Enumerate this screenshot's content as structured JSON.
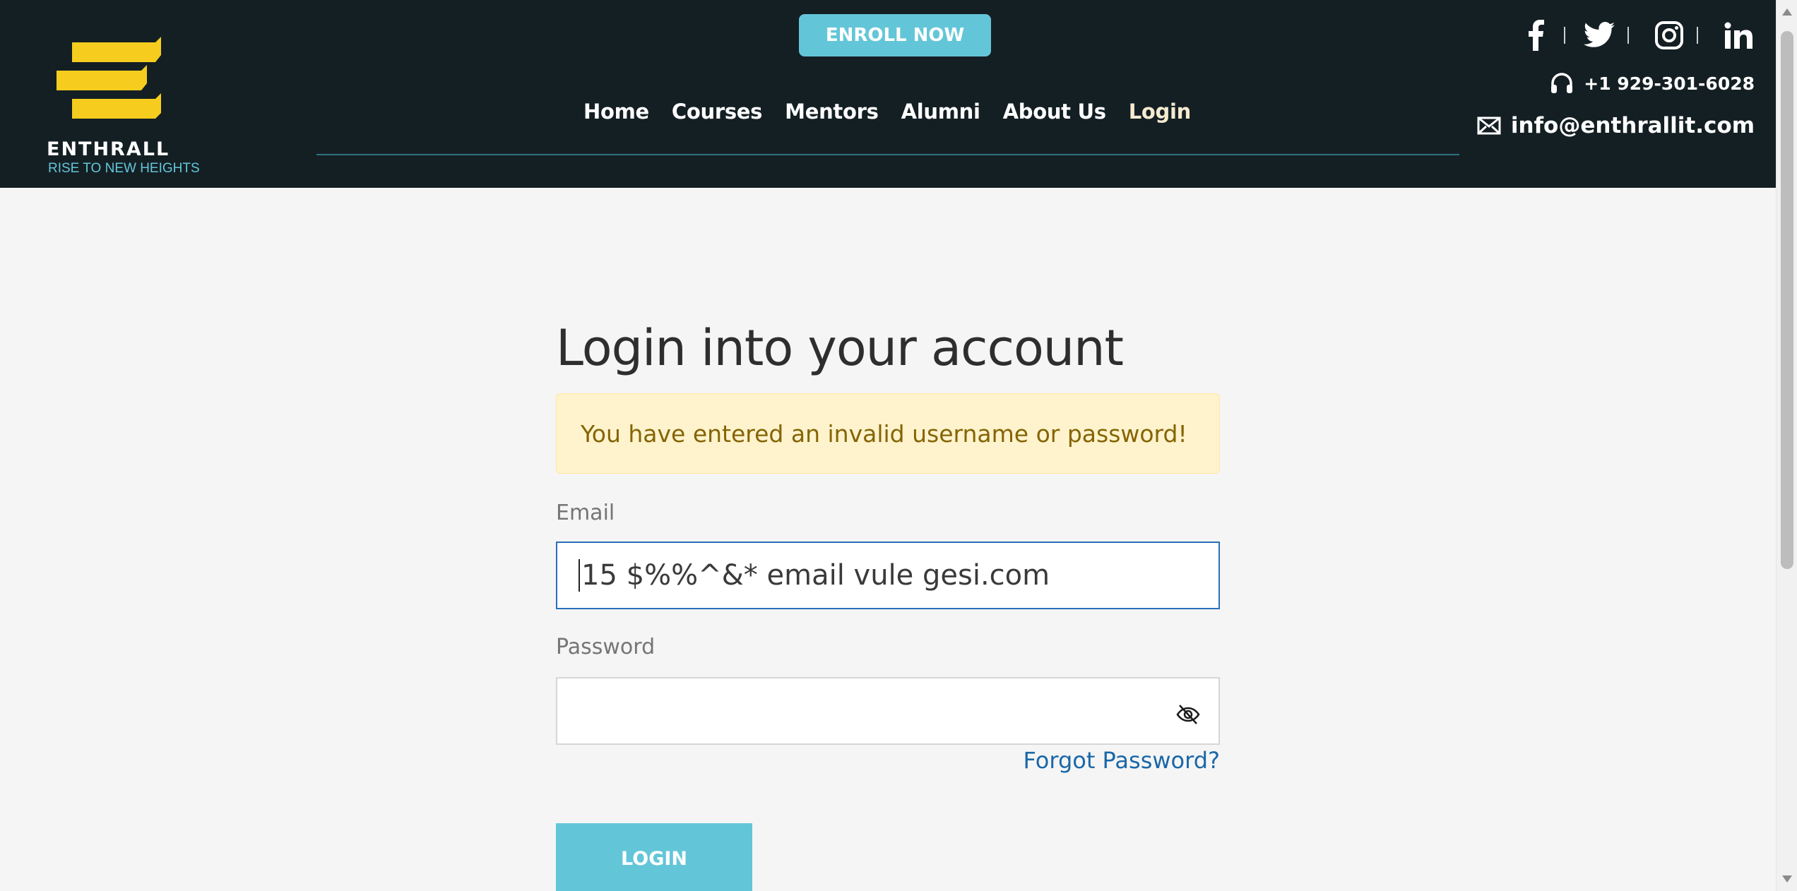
{
  "brand": {
    "name": "ENTHRALL",
    "tagline": "RISE TO NEW HEIGHTS",
    "logo_color": "#f6cd1e",
    "accent": "#63c6d8",
    "header_bg": "#141f24"
  },
  "header": {
    "enroll_label": "ENROLL NOW",
    "nav": [
      "Home",
      "Courses",
      "Mentors",
      "Alumni",
      "About Us",
      "Login"
    ],
    "active_nav": "Login",
    "social": [
      "facebook-icon",
      "twitter-icon",
      "instagram-icon",
      "linkedin-icon"
    ],
    "phone": "+1 929-301-6028",
    "email": "info@enthrallit.com"
  },
  "login": {
    "title": "Login into your account",
    "alert": "You have entered an invalid username or password!",
    "email_label": "Email",
    "email_value": "15 $%%^&* email vule gesi.com",
    "password_label": "Password",
    "password_value": "",
    "forgot_label": "Forgot Password?",
    "submit_label": "LOGIN"
  }
}
